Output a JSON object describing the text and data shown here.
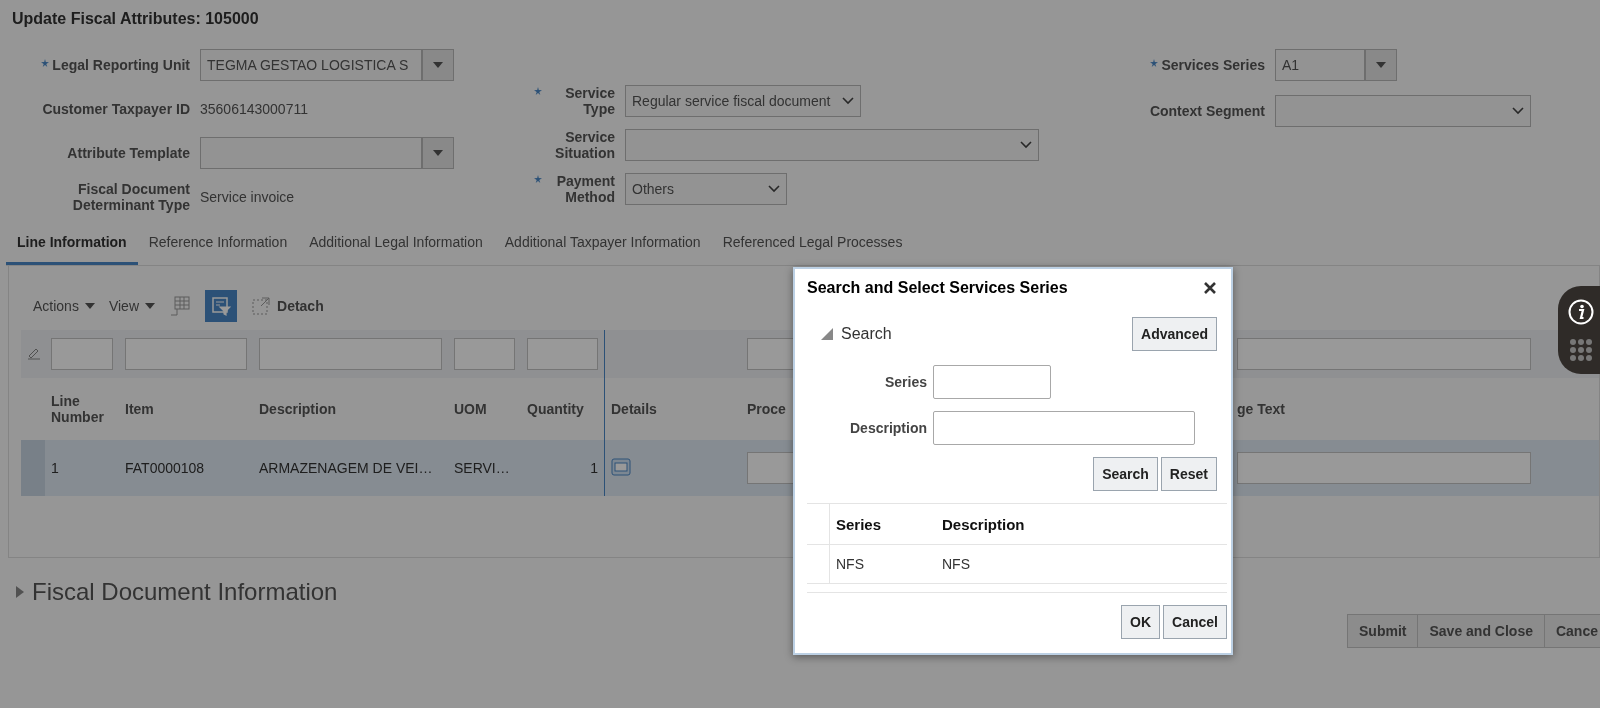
{
  "page": {
    "title": "Update Fiscal Attributes: 105000"
  },
  "form": {
    "columns": [
      {
        "fields": [
          {
            "label": "Legal Reporting Unit",
            "required": true,
            "kind": "lov",
            "value": "TEGMA GESTAO LOGISTICA S"
          },
          {
            "label": "Customer Taxpayer ID",
            "required": false,
            "kind": "readonly",
            "value": "35606143000711"
          },
          {
            "label": "Attribute Template",
            "required": false,
            "kind": "lov"
          },
          {
            "label": "Fiscal Document Determinant Type",
            "required": false,
            "kind": "readonly",
            "value": "Service invoice"
          }
        ]
      },
      {
        "fields": [
          {
            "label": "Service Type",
            "required": true,
            "kind": "select",
            "value": "Regular service fiscal document"
          },
          {
            "label": "Service Situation",
            "required": false,
            "kind": "select"
          },
          {
            "label": "Payment Method",
            "required": true,
            "kind": "select",
            "value": "Others"
          }
        ]
      },
      {
        "fields": [
          {
            "label": "Services Series",
            "required": true,
            "kind": "lov",
            "value": "A1"
          },
          {
            "label": "Context Segment",
            "required": false,
            "kind": "select"
          }
        ]
      }
    ]
  },
  "tabs": [
    {
      "label": "Line Information",
      "selected": true
    },
    {
      "label": "Reference Information",
      "selected": false
    },
    {
      "label": "Additional Legal Information",
      "selected": false
    },
    {
      "label": "Additional Taxpayer Information",
      "selected": false
    },
    {
      "label": "Referenced Legal Processes",
      "selected": false
    }
  ],
  "toolbar": {
    "menus": [
      "Actions",
      "View"
    ],
    "filter_selected": true,
    "detach": "Detach"
  },
  "table": {
    "columns": [
      {
        "label": "Line Number",
        "filter": true
      },
      {
        "label": "Item",
        "filter": true
      },
      {
        "label": "Description",
        "filter": true
      },
      {
        "label": "UOM",
        "filter": true
      },
      {
        "label": "Quantity",
        "filter": true
      },
      {
        "label": "Details",
        "filter": false
      },
      {
        "label": "Proce",
        "filter": true
      },
      {
        "label": "ge Text",
        "filter": true
      }
    ],
    "rows": [
      {
        "selected": true,
        "cells": [
          {
            "kind": "text",
            "value": "1"
          },
          {
            "kind": "text",
            "value": "FAT0000108"
          },
          {
            "kind": "text",
            "value": "ARMAZENAGEM DE VEI…"
          },
          {
            "kind": "text",
            "value": "SERVI…"
          },
          {
            "kind": "number",
            "value": "1"
          },
          {
            "kind": "icon"
          },
          {
            "kind": "input"
          },
          {
            "kind": "input"
          }
        ]
      }
    ]
  },
  "section": {
    "label": "Fiscal Document Information",
    "expanded": false
  },
  "actions": [
    "Submit",
    "Save and Close",
    "Cance"
  ],
  "dialog": {
    "title": "Search and Select Services Series",
    "search": {
      "label": "Search",
      "expanded": true,
      "advanced": "Advanced",
      "fields": [
        {
          "label": "Series"
        },
        {
          "label": "Description"
        }
      ],
      "buttons": [
        "Search",
        "Reset"
      ]
    },
    "results": {
      "columns": [
        "Series",
        "Description"
      ],
      "rows": [
        {
          "selected": false,
          "cells": [
            "NFS",
            "NFS"
          ]
        }
      ]
    },
    "buttons": [
      "OK",
      "Cancel"
    ]
  }
}
